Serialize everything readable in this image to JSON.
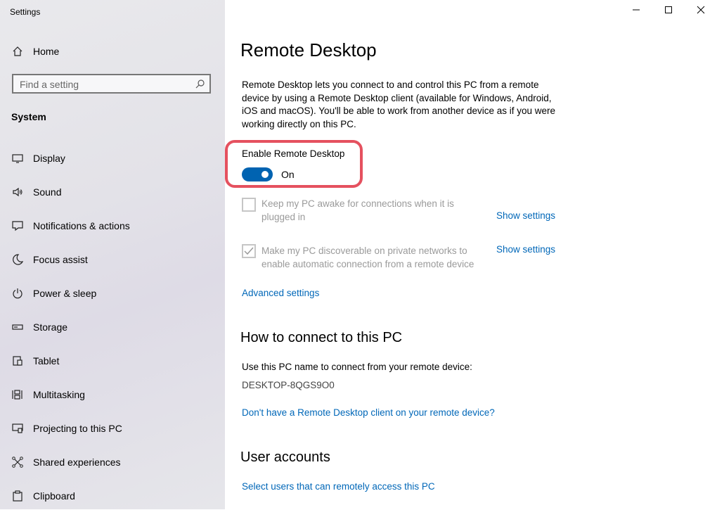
{
  "window": {
    "title": "Settings",
    "minimize_icon": "minimize-icon",
    "maximize_icon": "maximize-icon",
    "close_icon": "close-icon"
  },
  "sidebar": {
    "home_label": "Home",
    "search_placeholder": "Find a setting",
    "section_title": "System",
    "items": [
      {
        "label": "Display",
        "icon": "display-icon"
      },
      {
        "label": "Sound",
        "icon": "speaker-icon"
      },
      {
        "label": "Notifications & actions",
        "icon": "notification-icon"
      },
      {
        "label": "Focus assist",
        "icon": "moon-icon"
      },
      {
        "label": "Power & sleep",
        "icon": "power-icon"
      },
      {
        "label": "Storage",
        "icon": "storage-icon"
      },
      {
        "label": "Tablet",
        "icon": "tablet-icon"
      },
      {
        "label": "Multitasking",
        "icon": "multitasking-icon"
      },
      {
        "label": "Projecting to this PC",
        "icon": "projecting-icon"
      },
      {
        "label": "Shared experiences",
        "icon": "shared-experiences-icon"
      },
      {
        "label": "Clipboard",
        "icon": "clipboard-icon"
      }
    ]
  },
  "main": {
    "title": "Remote Desktop",
    "description": "Remote Desktop lets you connect to and control this PC from a remote device by using a Remote Desktop client (available for Windows, Android, iOS and macOS). You'll be able to work from another device as if you were working directly on this PC.",
    "toggle": {
      "label": "Enable Remote Desktop",
      "state": "On",
      "checked": true
    },
    "options": [
      {
        "text": "Keep my PC awake for connections when it is plugged in",
        "checked": false,
        "link": "Show settings"
      },
      {
        "text": "Make my PC discoverable on private networks to enable automatic connection from a remote device",
        "checked": true,
        "link": "Show settings"
      }
    ],
    "advanced_link": "Advanced settings",
    "connect": {
      "heading": "How to connect to this PC",
      "instruction": "Use this PC name to connect from your remote device:",
      "pc_name": "DESKTOP-8QGS9O0",
      "client_link": "Don't have a Remote Desktop client on your remote device?"
    },
    "accounts": {
      "heading": "User accounts",
      "link": "Select users that can remotely access this PC"
    }
  },
  "colors": {
    "accent": "#0063b1",
    "link": "#0067b8",
    "highlight": "#e5515f"
  }
}
